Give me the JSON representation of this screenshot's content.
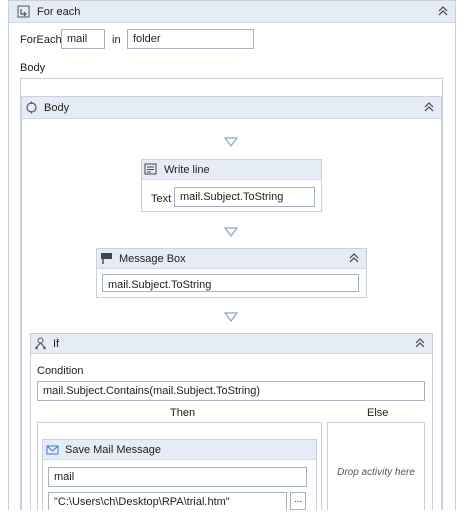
{
  "foreach": {
    "title": "For each",
    "foreach_label": "ForEach",
    "item_value": "mail",
    "in_label": "in",
    "collection_value": "folder",
    "body_label": "Body"
  },
  "body_seq": {
    "title": "Body"
  },
  "write_line": {
    "title": "Write line",
    "text_label": "Text",
    "text_value": "mail.Subject.ToString"
  },
  "message_box": {
    "title": "Message Box",
    "value": "mail.Subject.ToString"
  },
  "if_activity": {
    "title": "If",
    "condition_label": "Condition",
    "condition_value": "mail.Subject.Contains(mail.Subject.ToString)",
    "then_label": "Then",
    "else_label": "Else",
    "drop_text": "Drop activity here"
  },
  "save_mail": {
    "title": "Save Mail Message",
    "mail_value": "mail",
    "path_value": "\"C:\\Users\\ch\\Desktop\\RPA\\trial.htm\"",
    "browse_label": "..."
  },
  "icons": [
    "foreach-icon",
    "sequence-icon",
    "write-line-icon",
    "message-box-icon",
    "if-icon",
    "mail-icon",
    "collapse-icon",
    "drop-arrow-icon"
  ],
  "colors": {
    "header": "#e6ecf5",
    "border": "#c9d1dc",
    "input_border": "#a8b3c1",
    "arrow": "#8fa4bf"
  }
}
